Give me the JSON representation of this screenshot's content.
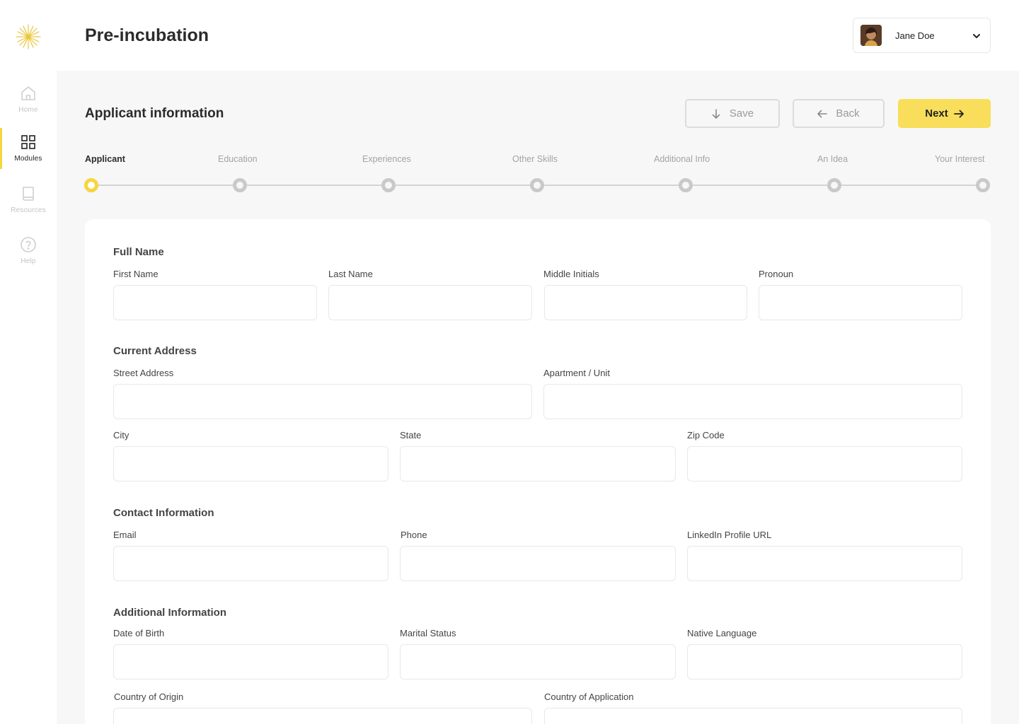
{
  "sidebar": {
    "items": [
      {
        "label": "Home",
        "icon": "home-icon"
      },
      {
        "label": "Modules",
        "icon": "grid-icon"
      },
      {
        "label": "Resources",
        "icon": "book-icon"
      },
      {
        "label": "Help",
        "icon": "help-icon"
      }
    ]
  },
  "header": {
    "title": "Pre-incubation",
    "user": {
      "name": "Jane Doe"
    }
  },
  "main": {
    "section_title": "Applicant information",
    "buttons": {
      "save": "Save",
      "back": "Back",
      "next": "Next"
    },
    "steps": [
      "Applicant",
      "Education",
      "Experiences",
      "Other Skills",
      "Additional Info",
      "An Idea",
      "Your Interest"
    ],
    "active_step": 0
  },
  "form": {
    "full_name": {
      "title": "Full Name",
      "first_name": "First Name",
      "last_name": "Last Name",
      "middle_initials": "Middle Initials",
      "pronoun": "Pronoun"
    },
    "address": {
      "title": "Current Address",
      "street": "Street Address",
      "apartment": "Apartment / Unit",
      "city": "City",
      "state": "State",
      "zip": "Zip Code"
    },
    "contact": {
      "title": "Contact Information",
      "email": "Email",
      "phone": "Phone",
      "linkedin": "LinkedIn Profile URL"
    },
    "additional": {
      "title": "Additional Information",
      "dob": "Date of Birth",
      "marital": "Marital Status",
      "language": "Native Language",
      "origin": "Country of Origin",
      "application": "Country of Application"
    }
  },
  "colors": {
    "accent": "#f8de5a",
    "active_indicator": "#f5d63f"
  }
}
